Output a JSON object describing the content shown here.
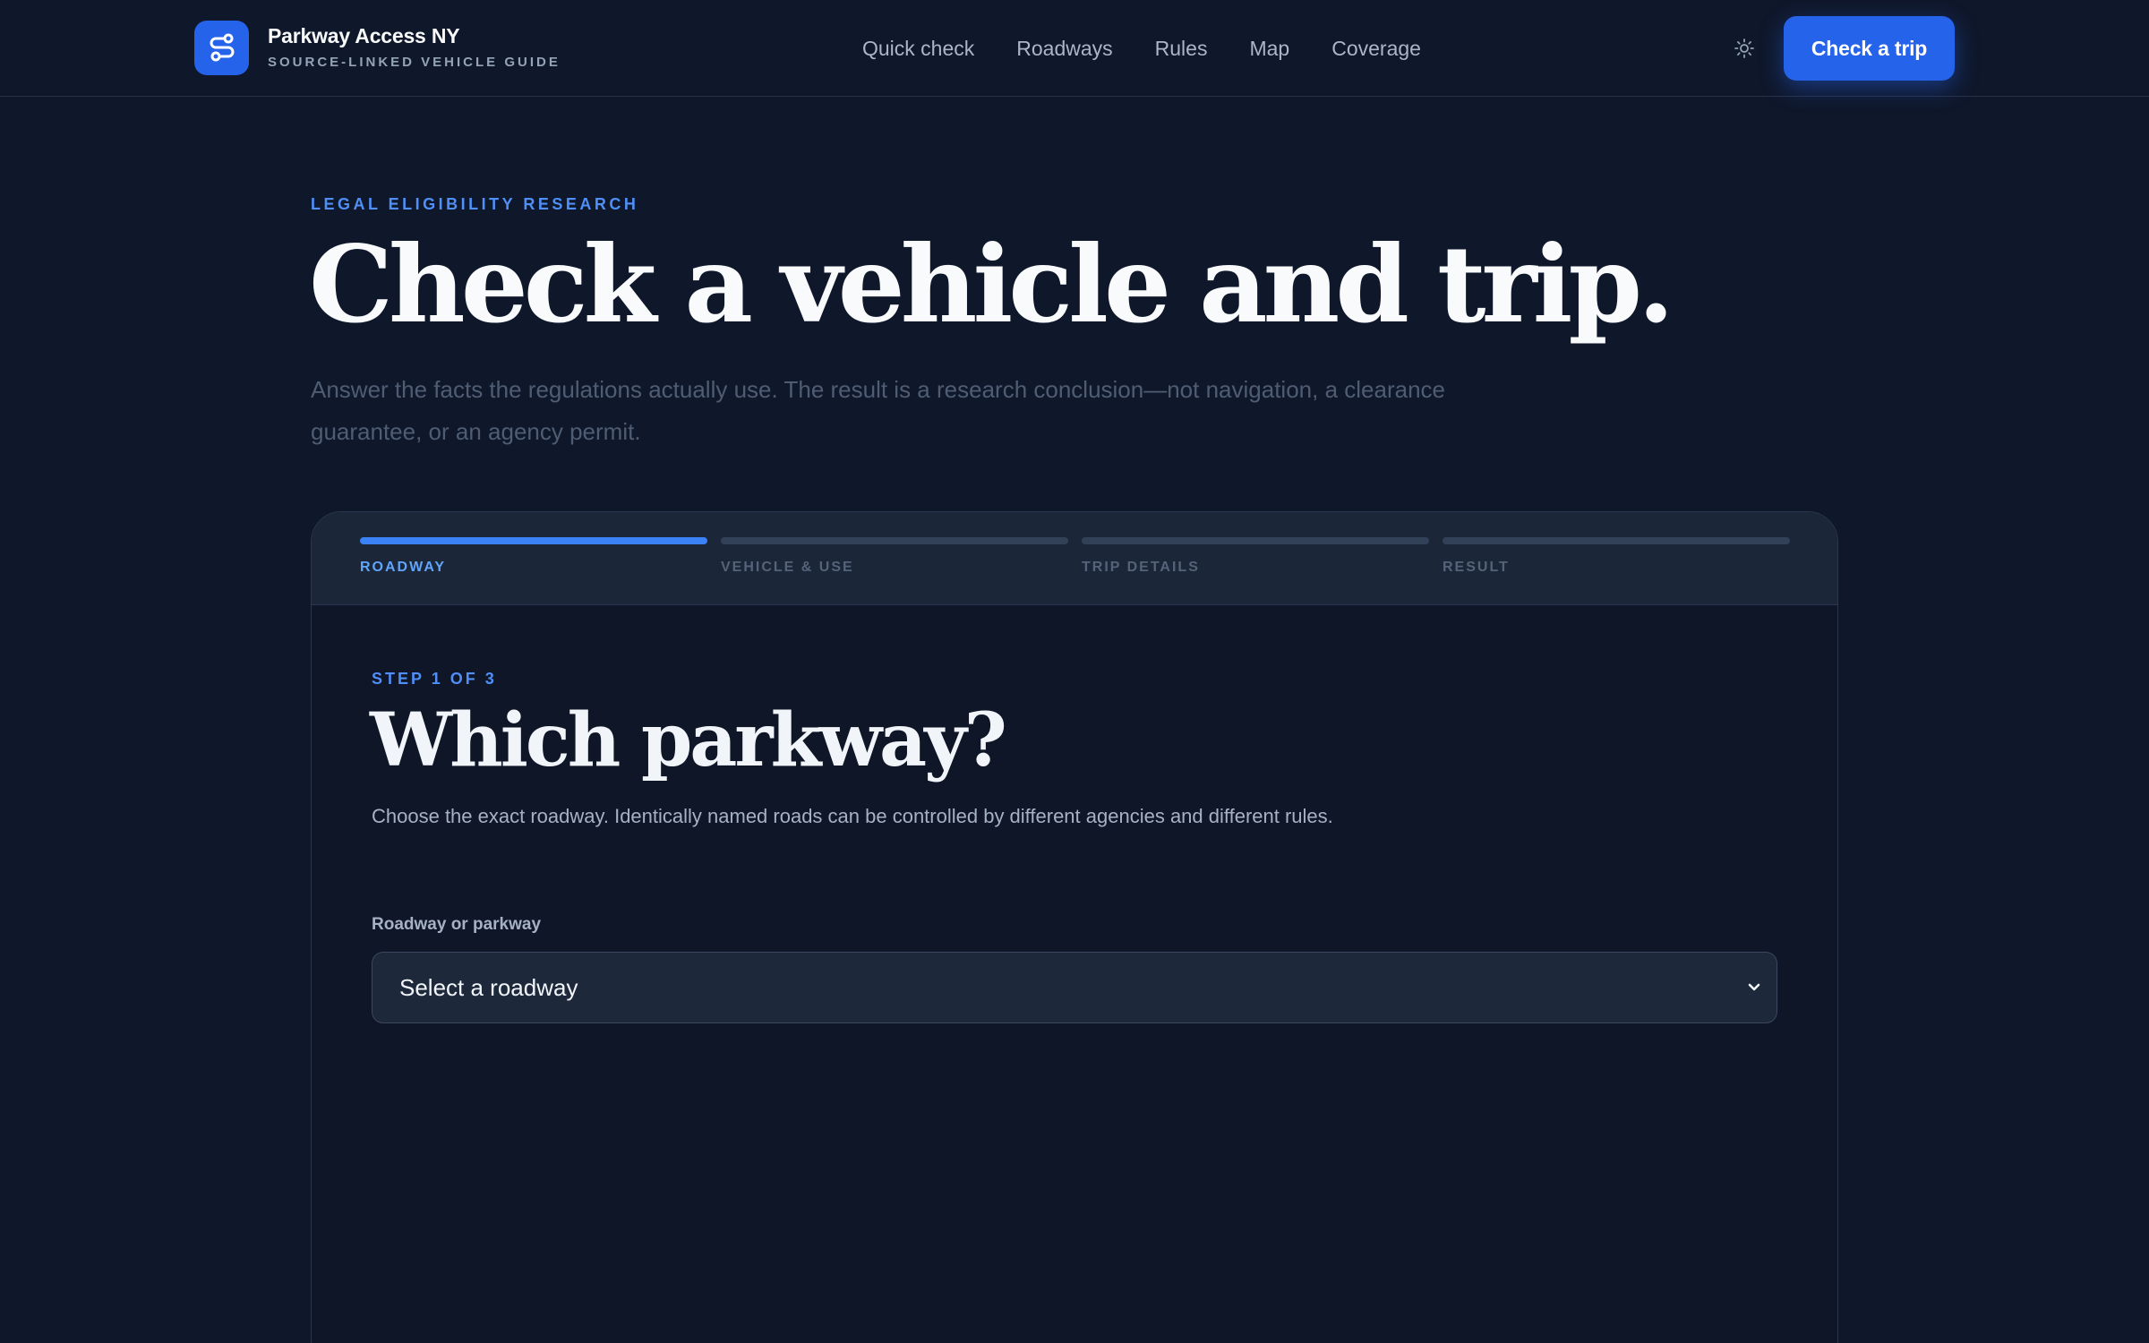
{
  "brand": {
    "name": "Parkway Access NY",
    "tagline": "SOURCE-LINKED VEHICLE GUIDE"
  },
  "nav": {
    "items": [
      {
        "label": "Quick check"
      },
      {
        "label": "Roadways"
      },
      {
        "label": "Rules"
      },
      {
        "label": "Map"
      },
      {
        "label": "Coverage"
      }
    ],
    "theme_icon": "sun-icon",
    "cta_label": "Check a trip"
  },
  "hero": {
    "eyebrow": "LEGAL ELIGIBILITY RESEARCH",
    "title": "Check a vehicle and trip.",
    "subtitle": "Answer the facts the regulations actually use. The result is a research conclusion—not navigation, a clearance guarantee, or an agency permit."
  },
  "wizard": {
    "steps": [
      {
        "label": "ROADWAY",
        "active": true
      },
      {
        "label": "VEHICLE & USE",
        "active": false
      },
      {
        "label": "TRIP DETAILS",
        "active": false
      },
      {
        "label": "RESULT",
        "active": false
      }
    ],
    "step_eyebrow": "STEP 1 OF 3",
    "step_title": "Which parkway?",
    "step_description": "Choose the exact roadway. Identically named roads can be controlled by different agencies and different rules.",
    "field_label": "Roadway or parkway",
    "select_value": "Select a roadway"
  },
  "colors": {
    "background": "#0f172a",
    "accent": "#2563eb",
    "accent_light": "#60a5fa",
    "card": "#0e1628",
    "progress_bg": "#1b2639"
  }
}
